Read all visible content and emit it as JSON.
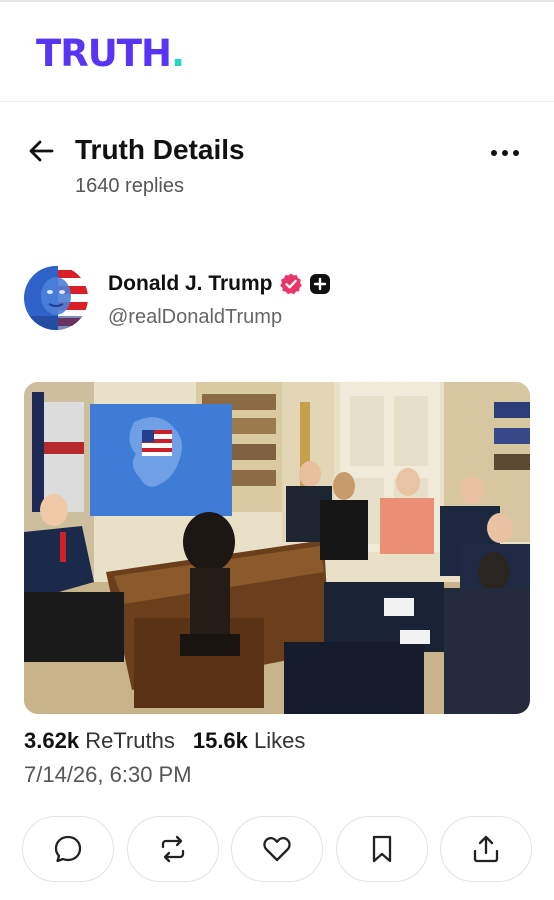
{
  "app": {
    "logo_text": "TRUTH",
    "logo_dot": ".",
    "brand_color": "#5a34f5",
    "accent_color": "#27d5c6"
  },
  "header": {
    "title": "Truth Details",
    "replies": "1640 replies",
    "back_icon": "arrow-left-icon",
    "more_icon": "more-horizontal-icon"
  },
  "post": {
    "author_name": "Donald J. Trump",
    "handle": "@realDonaldTrump",
    "verified_icon": "verified-badge-icon",
    "badge_icon": "plus-badge-icon",
    "verified_color": "#e8366a",
    "retruths_count": "3.62k",
    "retruths_label": "ReTruths",
    "likes_count": "15.6k",
    "likes_label": "Likes",
    "timestamp": "7/14/26, 6:30 PM"
  },
  "actions": [
    {
      "icon": "reply-icon"
    },
    {
      "icon": "retruth-icon"
    },
    {
      "icon": "like-icon"
    },
    {
      "icon": "bookmark-icon"
    },
    {
      "icon": "share-icon"
    }
  ]
}
